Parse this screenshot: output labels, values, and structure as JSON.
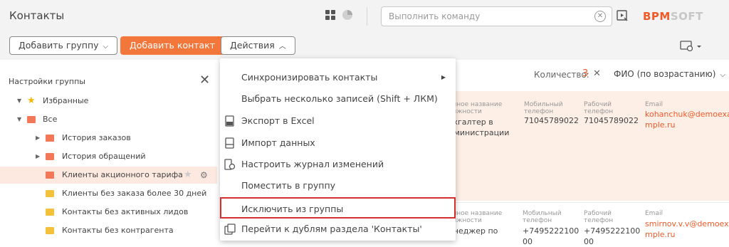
{
  "header": {
    "title": "Контакты",
    "command_placeholder": "Выполнить команду",
    "logo": {
      "part1": "BPM",
      "part2": "SOFT"
    }
  },
  "toolbar": {
    "add_group": "Добавить группу",
    "add_contact": "Добавить контакт",
    "actions": "Действия"
  },
  "sidebar": {
    "title": "Настройки группы",
    "items": [
      {
        "label": "Избранные"
      },
      {
        "label": "Все"
      },
      {
        "label": "История заказов"
      },
      {
        "label": "История обращений"
      },
      {
        "label": "Клиенты акционного тарифа"
      },
      {
        "label": "Клиенты без заказа более 30 дней"
      },
      {
        "label": "Контакты без активных лидов"
      },
      {
        "label": "Контакты без контрагента"
      }
    ]
  },
  "list": {
    "count_label": "Количество:",
    "count_value": "3",
    "sort_label": "ФИО (по возрастанию)",
    "columns": {
      "job": "олное название\nолжности",
      "mobile": "Мобильный\nтелефон",
      "work": "Рабочий\nтелефон",
      "email": "Email"
    },
    "rows": [
      {
        "job": "ухгалтер в\nдминистрации",
        "mobile": "71045789022",
        "work": "71045789022",
        "email": "kohanchuk@demoexa\nmple.ru"
      },
      {
        "job": "енеджер по",
        "mobile": "+7495222100\n00",
        "work": "+7495222100\n00",
        "email": "smirnov.v.v@demoexa\nmple.ru"
      }
    ]
  },
  "actions_menu": {
    "items": [
      {
        "label": "Синхронизировать контакты"
      },
      {
        "label": "Выбрать несколько записей (Shift + ЛКМ)"
      },
      {
        "label": "Экспорт в Excel"
      },
      {
        "label": "Импорт данных"
      },
      {
        "label": "Настроить журнал изменений"
      },
      {
        "label": "Поместить в группу"
      },
      {
        "label": "Исключить из группы"
      },
      {
        "label": "Перейти к дублям раздела 'Контакты'"
      }
    ]
  },
  "colors": {
    "accent": "#f3763b",
    "highlight_border": "#d62f2f",
    "selected_row": "#fde9e0"
  }
}
